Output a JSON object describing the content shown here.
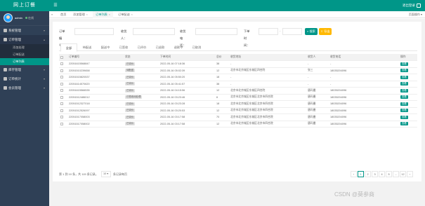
{
  "app": {
    "brand": "网上订餐",
    "menu_toggle_icon": "hamburger-icon",
    "logout": "退出登录",
    "accent": "#009688"
  },
  "sidebar": {
    "username": "admin",
    "status": "在线",
    "items": [
      {
        "label": "系统管理",
        "open": false
      },
      {
        "label": "订单管理",
        "open": true,
        "children": [
          {
            "label": "添加处理",
            "active": false
          },
          {
            "label": "订单配送",
            "active": false
          },
          {
            "label": "订单列表",
            "active": true
          }
        ]
      },
      {
        "label": "库存管理",
        "open": false
      },
      {
        "label": "订单统计",
        "open": false
      },
      {
        "label": "会员管理",
        "open": false
      }
    ]
  },
  "tabstrip": {
    "tabs": [
      {
        "label": "首页",
        "active": false
      },
      {
        "label": "添加管理",
        "active": false
      },
      {
        "label": "订单列表",
        "active": true
      },
      {
        "label": "订单配送",
        "active": false
      }
    ],
    "right_label": "页面操作"
  },
  "filter": {
    "order_no_label": "订单编号：",
    "receiver_label": "收货人：",
    "phone_label": "收货电话：",
    "time_label": "下单时间：",
    "search_label": "搜索",
    "export_label": "导出"
  },
  "status_tabs": [
    "全部",
    "待配送",
    "配送中",
    "已签收",
    "已评价",
    "已退款",
    "退款中",
    "已取消"
  ],
  "table": {
    "headers": [
      "",
      "订单编号",
      "状态",
      "下单时间",
      "总价",
      "收货地址",
      "收货人",
      "收货电话",
      "操作"
    ],
    "rows": [
      {
        "no": "22051615568847",
        "status": "已评价",
        "status_style": "grey",
        "time": "2022-05-16 07:18:36",
        "total": "38",
        "address": "-",
        "receiver": "-",
        "phone": "-",
        "op": "查看"
      },
      {
        "no": "22051510239658",
        "status": "待配送",
        "status_style": "grey",
        "time": "2022-05-16 05:02:39",
        "total": "12",
        "address": "北京市北京城区东城区四合院",
        "receiver": "张三",
        "phone": "18035204096",
        "op": "查看"
      },
      {
        "no": "22051515820537",
        "status": "已评价",
        "status_style": "grey",
        "time": "2022-05-16 05:50:20",
        "total": "18",
        "address": "-",
        "receiver": "-",
        "phone": "-",
        "op": "查看"
      },
      {
        "no": "22051614570620",
        "status": "已评价",
        "status_style": "grey",
        "time": "2022-05-16 05:41:57",
        "total": "38",
        "address": "-",
        "receiver": "-",
        "phone": "-",
        "op": "查看"
      },
      {
        "no": "22051615566535",
        "status": "已评价",
        "status_style": "grey",
        "time": "2022-05-16 04:15:56",
        "total": "12",
        "address": "北京市北京城区东城区四合院",
        "receiver": "唐玛曼",
        "phone": "18035204096",
        "op": "查看"
      },
      {
        "no": "22051512486012",
        "status": "已签收待处理",
        "status_style": "grey",
        "time": "2022-05-16 03:23:46",
        "total": "6",
        "address": "北京市北京城区东城区北京市四合院",
        "receiver": "唐玛曼",
        "phone": "18035204096",
        "op": "查看"
      },
      {
        "no": "22051512327018",
        "status": "已评价",
        "status_style": "grey",
        "time": "2022-05-16 03:23:28",
        "total": "18",
        "address": "北京市北京城区东城区北京市四合院",
        "receiver": "唐玛曼",
        "phone": "18035204096",
        "op": "查看"
      },
      {
        "no": "22051512526097",
        "status": "已评价",
        "status_style": "grey",
        "time": "2022-05-16 03:20:53",
        "total": "12",
        "address": "北京市北京城区东城区北京市四合院",
        "receiver": "唐玛曼",
        "phone": "18035204096",
        "op": "查看"
      },
      {
        "no": "22051517058003",
        "status": "已评价",
        "status_style": "grey",
        "time": "2022-05-16 03:17:58",
        "total": "70",
        "address": "北京市北京城区东城区北京市四合院",
        "receiver": "唐玛曼",
        "phone": "18035204096",
        "op": "查看"
      },
      {
        "no": "22051517058002",
        "status": "已评价",
        "status_style": "grey",
        "time": "2022-05-16 03:17:58",
        "total": "12",
        "address": "北京市北京城区东城区北京市四合院",
        "receiver": "唐玛曼",
        "phone": "18035204096",
        "op": "查看"
      }
    ]
  },
  "pager": {
    "info": "第 1 到 10 条，共 115 条记录。",
    "page_size": "10",
    "page_size_label": "条记录每页",
    "pages": [
      "‹",
      "1",
      "2",
      "3",
      "4",
      "5",
      "…",
      "12",
      "›"
    ],
    "current": "1"
  },
  "watermark": "CSDN @莫参商"
}
